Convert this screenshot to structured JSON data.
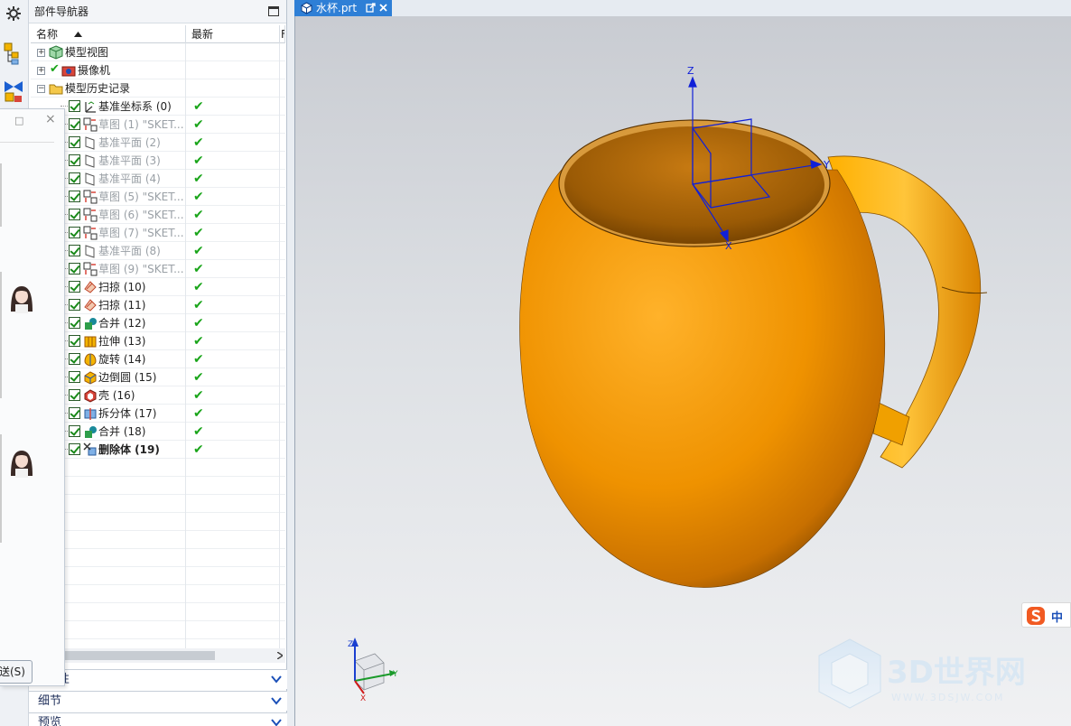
{
  "navigator": {
    "title": "部件导航器",
    "col_name": "名称",
    "col_latest": "最新",
    "col_extra": "F"
  },
  "tree": {
    "top_nodes": [
      {
        "label": "模型视图"
      },
      {
        "label": "摄像机"
      },
      {
        "label": "模型历史记录"
      }
    ],
    "features": [
      {
        "label": "基准坐标系 (0)",
        "style": "normal",
        "icon": "datum-csys-icon"
      },
      {
        "label": "草图 (1) \"SKET...",
        "style": "dim",
        "icon": "sketch-icon"
      },
      {
        "label": "基准平面 (2)",
        "style": "dim",
        "icon": "datum-plane-icon"
      },
      {
        "label": "基准平面 (3)",
        "style": "dim",
        "icon": "datum-plane-icon"
      },
      {
        "label": "基准平面 (4)",
        "style": "dim",
        "icon": "datum-plane-icon"
      },
      {
        "label": "草图 (5) \"SKET...",
        "style": "dim",
        "icon": "sketch-icon"
      },
      {
        "label": "草图 (6) \"SKET...",
        "style": "dim",
        "icon": "sketch-icon"
      },
      {
        "label": "草图 (7) \"SKET...",
        "style": "dim",
        "icon": "sketch-icon"
      },
      {
        "label": "基准平面 (8)",
        "style": "dim",
        "icon": "datum-plane-icon"
      },
      {
        "label": "草图 (9) \"SKET...",
        "style": "dim",
        "icon": "sketch-icon"
      },
      {
        "label": "扫掠 (10)",
        "style": "normal",
        "icon": "sweep-icon"
      },
      {
        "label": "扫掠 (11)",
        "style": "normal",
        "icon": "sweep-icon"
      },
      {
        "label": "合并 (12)",
        "style": "normal",
        "icon": "unite-icon"
      },
      {
        "label": "拉伸 (13)",
        "style": "normal",
        "icon": "extrude-icon"
      },
      {
        "label": "旋转 (14)",
        "style": "normal",
        "icon": "revolve-icon"
      },
      {
        "label": "边倒圆 (15)",
        "style": "normal",
        "icon": "edge-blend-icon"
      },
      {
        "label": "壳 (16)",
        "style": "normal",
        "icon": "shell-icon"
      },
      {
        "label": "拆分体 (17)",
        "style": "normal",
        "icon": "split-body-icon"
      },
      {
        "label": "合并 (18)",
        "style": "normal",
        "icon": "unite-icon"
      },
      {
        "label": "删除体 (19)",
        "style": "bold",
        "icon": "delete-body-icon"
      }
    ],
    "latest_mark": "✔"
  },
  "sections": [
    {
      "label": "性"
    },
    {
      "label": "细节"
    },
    {
      "label": "预览"
    }
  ],
  "popup": {
    "restore": "□",
    "close": "×",
    "send_button": "送(S)"
  },
  "viewport": {
    "tab_label": "水杯.prt",
    "csys_labels": {
      "x": "X",
      "y": "Y",
      "z": "Z"
    },
    "triad_labels": {
      "x": "X",
      "y": "Y",
      "z": "Z"
    },
    "watermark_big": "3D世界网",
    "watermark_small": "WWW.3DSJW.COM",
    "ime_label": "中",
    "mug_color": "#f59a00"
  }
}
